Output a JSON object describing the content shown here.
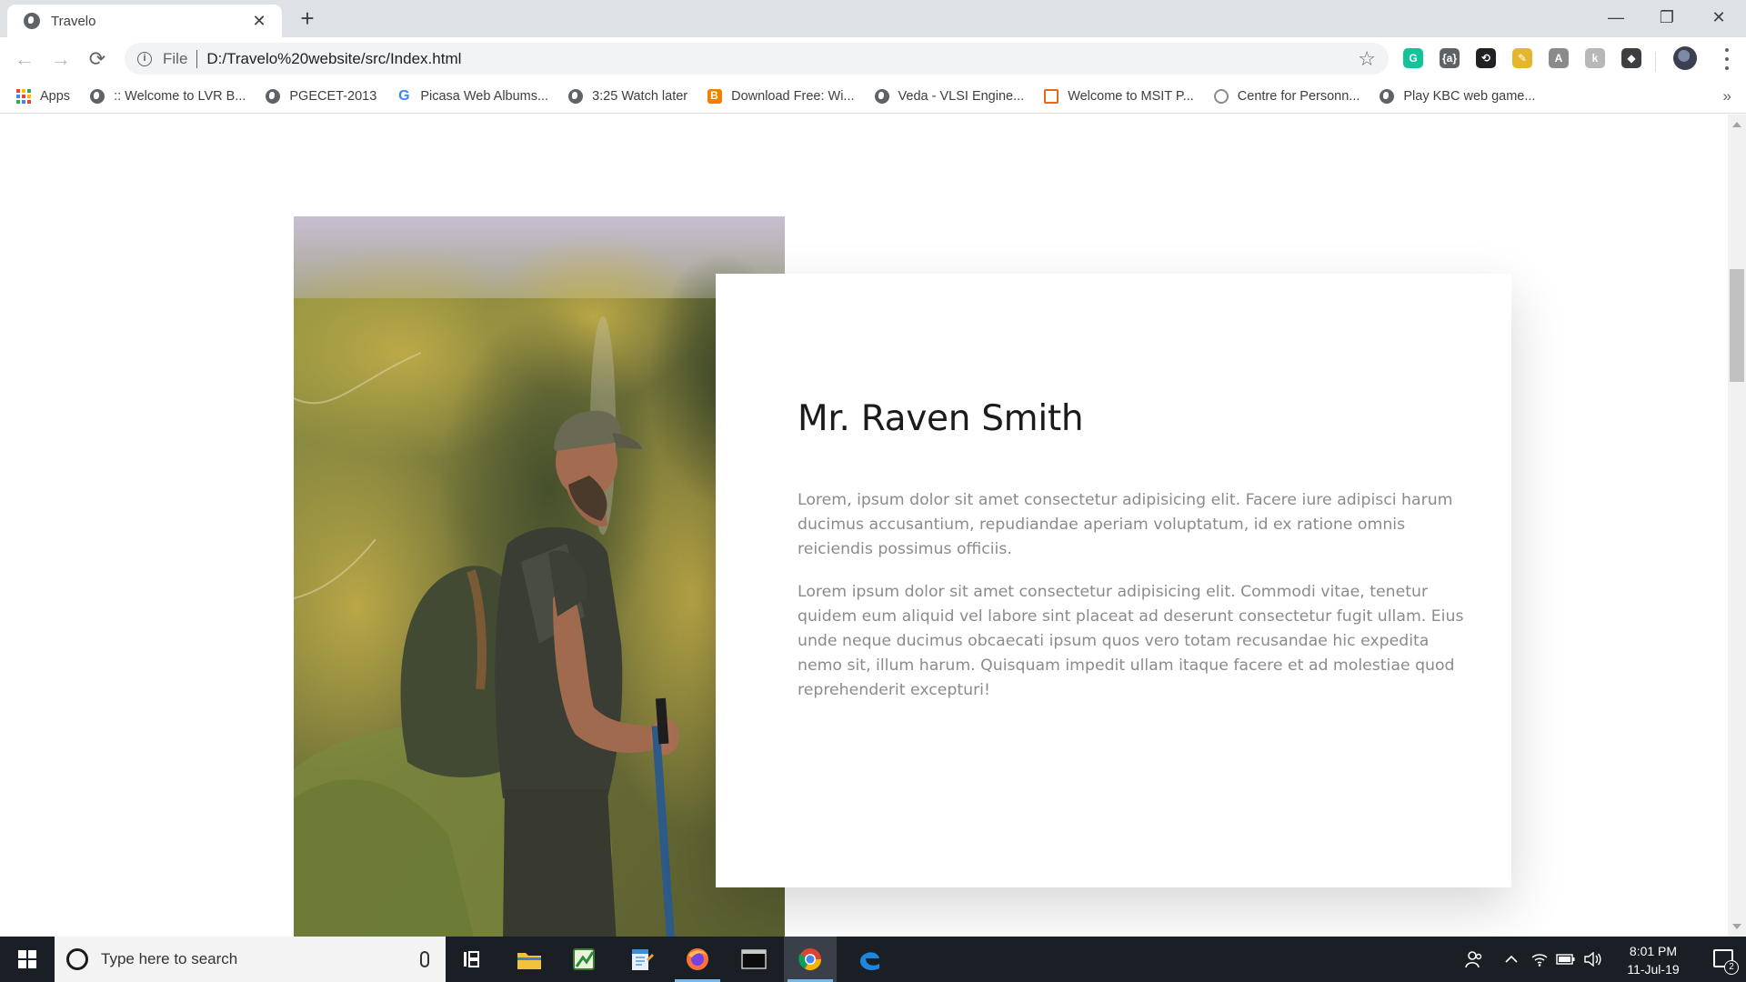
{
  "browser": {
    "tab": {
      "title": "Travelo",
      "close_glyph": "✕"
    },
    "new_tab_glyph": "+",
    "window_controls": {
      "minimize": "—",
      "maximize": "❐",
      "close": "✕"
    },
    "toolbar": {
      "back": "←",
      "forward": "→",
      "reload": "⟳"
    },
    "address_bar": {
      "info_glyph": "i",
      "scheme_label": "File",
      "url": "D:/Travelo%20website/src/Index.html",
      "star_glyph": "☆"
    },
    "extensions": [
      {
        "icon": "grammarly-icon",
        "glyph": "G",
        "color": "#15c39a"
      },
      {
        "icon": "json-viewer-icon",
        "glyph": "{a}",
        "color": "#5f6368"
      },
      {
        "icon": "sync-icon",
        "glyph": "⟲",
        "color": "#202124"
      },
      {
        "icon": "color-picker-icon",
        "glyph": "✎",
        "color": "#e6b52e"
      },
      {
        "icon": "angular-icon",
        "glyph": "A",
        "color": "#8a8a8a"
      },
      {
        "icon": "extension-k-icon",
        "glyph": "k",
        "color": "#b8b8b8"
      },
      {
        "icon": "layers-icon",
        "glyph": "◆",
        "color": "#3c4043"
      }
    ],
    "bookmarks": {
      "items": [
        {
          "label": "Apps",
          "icon": "apps-icon"
        },
        {
          "label": ":: Welcome to LVR B...",
          "icon": "globe-icon"
        },
        {
          "label": "PGECET-2013",
          "icon": "globe-icon"
        },
        {
          "label": "Picasa Web Albums...",
          "icon": "google-icon"
        },
        {
          "label": "3:25 Watch later",
          "icon": "globe-icon"
        },
        {
          "label": "Download Free: Wi...",
          "icon": "blogger-icon"
        },
        {
          "label": "Veda - VLSI Engine...",
          "icon": "globe-icon"
        },
        {
          "label": "Welcome to MSIT P...",
          "icon": "msit-icon"
        },
        {
          "label": "Centre for Personn...",
          "icon": "cpd-icon"
        },
        {
          "label": "Play KBC web game...",
          "icon": "globe-icon"
        }
      ],
      "more_glyph": "»"
    }
  },
  "page": {
    "profile": {
      "name": "Mr. Raven Smith",
      "paragraphs": [
        "Lorem, ipsum dolor sit amet consectetur adipisicing elit. Facere iure adipisci harum ducimus accusantium, repudiandae aperiam voluptatum, id ex ratione omnis reiciendis possimus officiis.",
        "Lorem ipsum dolor sit amet consectetur adipisicing elit. Commodi vitae, tenetur quidem eum aliquid vel labore sint placeat ad deserunt consectetur fugit ullam. Eius unde neque ducimus obcaecati ipsum quos vero totam recusandae hic expedita nemo sit, illum harum. Quisquam impedit ullam itaque facere et ad molestiae quod reprehenderit excepturi!"
      ]
    }
  },
  "taskbar": {
    "search_placeholder": "Type here to search",
    "pinned": [
      {
        "icon": "task-view-icon"
      },
      {
        "icon": "file-explorer-icon"
      },
      {
        "icon": "excel-like-icon"
      },
      {
        "icon": "notepad-icon"
      },
      {
        "icon": "firefox-icon"
      },
      {
        "icon": "terminal-icon"
      },
      {
        "icon": "chrome-icon"
      },
      {
        "icon": "edge-icon"
      }
    ],
    "clock": {
      "time": "8:01 PM",
      "date": "11-Jul-19"
    },
    "notification_count": "2"
  }
}
